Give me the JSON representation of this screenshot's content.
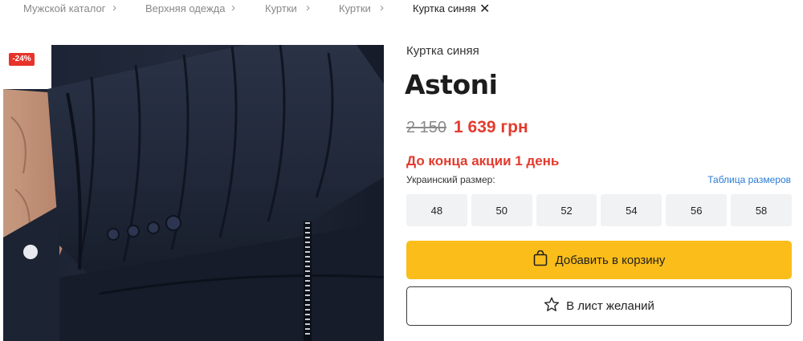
{
  "breadcrumb": {
    "items": [
      "Мужской каталог",
      "Верхняя одежда",
      "Куртки",
      "Куртки"
    ],
    "current": "Куртка синяя",
    "separator_icon": "chevron-right-icon",
    "close_icon": "close-icon"
  },
  "product": {
    "discount_badge": "-24%",
    "subtitle": "Куртка синяя",
    "brand": "Astoni",
    "old_price": "2 150",
    "new_price": "1 639 грн",
    "promo": "До конца акции 1 день",
    "size_label": "Украинский размер:",
    "size_table_link": "Таблица размеров",
    "sizes": [
      "48",
      "50",
      "52",
      "54",
      "56",
      "58"
    ],
    "add_to_cart": "Добавить в корзину",
    "wishlist": "В лист желаний"
  },
  "colors": {
    "accent_yellow": "#fbbd19",
    "price_red": "#e23b2e",
    "link_blue": "#2a7bd6",
    "badge_red": "#e8332a"
  }
}
